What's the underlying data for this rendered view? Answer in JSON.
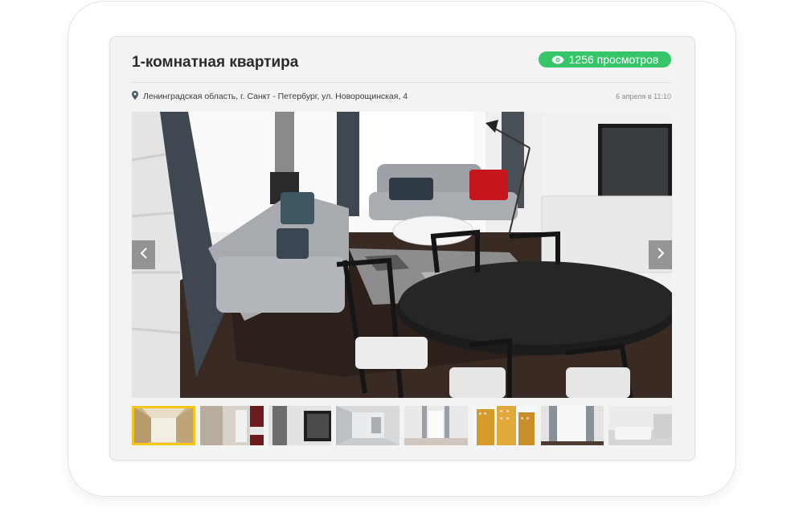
{
  "listing": {
    "title": "1-комнатная квартира",
    "views_label": "1256 просмотров",
    "address": "Ленинградская область, г. Санкт - Петербург, ул. Новорощинская, 4",
    "date": "6 апреля в 11:10"
  },
  "gallery": {
    "active_index": 0,
    "thumb_count": 8
  },
  "colors": {
    "badge": "#37c569",
    "active_thumb_border": "#f5c518"
  },
  "icons": {
    "views": "eye-icon",
    "location": "map-pin-icon",
    "prev": "chevron-left-icon",
    "next": "chevron-right-icon"
  }
}
